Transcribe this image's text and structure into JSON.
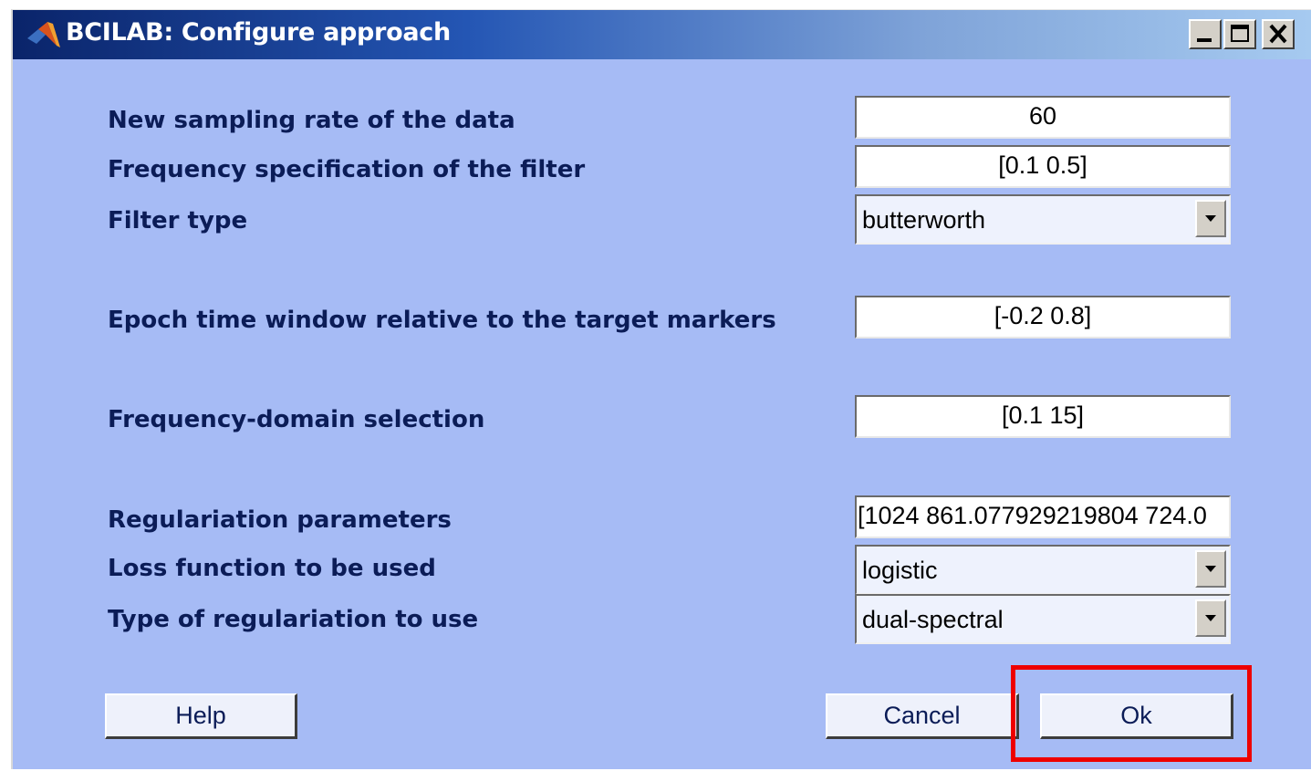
{
  "window": {
    "title": "BCILAB: Configure approach",
    "icon": "matlab-logo-icon"
  },
  "titlebar_buttons": {
    "minimize_icon": "minimize-icon",
    "maximize_icon": "maximize-icon",
    "close_icon": "close-icon"
  },
  "params": {
    "sampling_rate": {
      "label": "New sampling rate of the data",
      "value": "60"
    },
    "filter_freq": {
      "label": "Frequency specification of the filter",
      "value": "[0.1 0.5]"
    },
    "filter_type": {
      "label": "Filter type",
      "value": "butterworth"
    },
    "epoch_window": {
      "label": "Epoch time window relative to the target markers",
      "value": "[-0.2 0.8]"
    },
    "freq_selection": {
      "label": "Frequency-domain selection",
      "value": "[0.1 15]"
    },
    "regularization_params": {
      "label": "Regulariation parameters",
      "value": "[1024 861.077929219804 724.0"
    },
    "loss_function": {
      "label": "Loss function to be used",
      "value": "logistic"
    },
    "regularization_type": {
      "label": "Type of regulariation to use",
      "value": "dual-spectral"
    }
  },
  "buttons": {
    "help": "Help",
    "cancel": "Cancel",
    "ok": "Ok"
  },
  "colors": {
    "dialog_background": "#a6bbf5",
    "label_text": "#0b1c57",
    "highlight": "#ee0000"
  }
}
